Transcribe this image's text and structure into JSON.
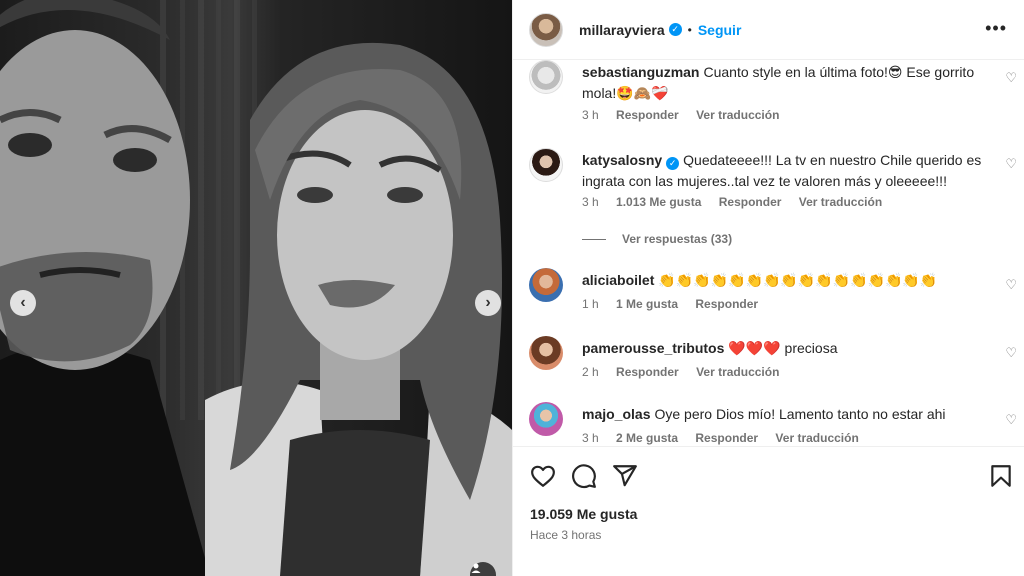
{
  "post": {
    "username": "millarayviera",
    "verified_mark": "✓",
    "separator": "•",
    "follow_label": "Seguir",
    "more_label": "•••",
    "nav_prev": "‹",
    "nav_next": "›",
    "tag_icon": "person-tag-icon"
  },
  "comments": [
    {
      "username": "sebastianguzman",
      "text": "Cuanto style en la última foto!😎 Ese gorrito mola!🤩🙈❤️‍🩹",
      "time": "3 h",
      "likes": "",
      "reply_label": "Responder",
      "translate_label": "Ver traducción"
    },
    {
      "username": "katysalosny",
      "verified": true,
      "text": "Quedateeee!!! La tv en nuestro Chile querido es ingrata con las mujeres..tal vez te valoren más y oleeeee!!!",
      "time": "3 h",
      "likes": "1.013 Me gusta",
      "reply_label": "Responder",
      "translate_label": "Ver traducción"
    },
    {
      "username": "aliciaboilet",
      "text": "👏👏👏👏👏👏👏👏👏👏👏👏👏👏👏👏",
      "time": "1 h",
      "likes": "1 Me gusta",
      "reply_label": "Responder",
      "translate_label": ""
    },
    {
      "username": "pamerousse_tributos",
      "text": "❤️❤️❤️ preciosa",
      "time": "2 h",
      "likes": "",
      "reply_label": "Responder",
      "translate_label": "Ver traducción"
    },
    {
      "username": "majo_olas",
      "text": "Oye pero Dios mío! Lamento tanto no estar ahi",
      "time": "3 h",
      "likes": "2 Me gusta",
      "reply_label": "Responder",
      "translate_label": "Ver traducción"
    }
  ],
  "view_replies": "Ver respuestas (33)",
  "footer": {
    "likes": "19.059 Me gusta",
    "time": "Hace 3 horas"
  },
  "colors": {
    "accent": "#0095f6",
    "text": "#262626",
    "muted": "#737373",
    "border": "#efefef"
  }
}
